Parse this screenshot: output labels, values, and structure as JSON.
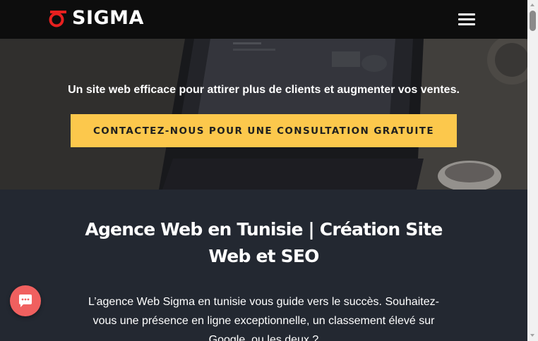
{
  "header": {
    "brand": "SIGMA",
    "logo_icon": "sigma-logo-icon",
    "menu_icon": "hamburger-menu-icon"
  },
  "hero": {
    "tagline": "Un site web efficace pour attirer plus de clients et augmenter vos ventes.",
    "cta_label": "CONTACTEZ-NOUS POUR UNE CONSULTATION GRATUITE",
    "cta_color": "#fcc84c"
  },
  "content": {
    "headline": "Agence Web en Tunisie | Création Site Web et SEO",
    "intro": "L’agence Web Sigma en tunisie vous guide vers le succès. Souhaitez-vous une présence en ligne exceptionnelle, un classement élevé sur Google, ou les deux ?"
  },
  "chat": {
    "icon": "chat-bubble-icon",
    "color": "#f0605f"
  },
  "colors": {
    "header_bg": "#0d0d0d",
    "content_bg": "#232831",
    "brand_red": "#e8201f"
  }
}
